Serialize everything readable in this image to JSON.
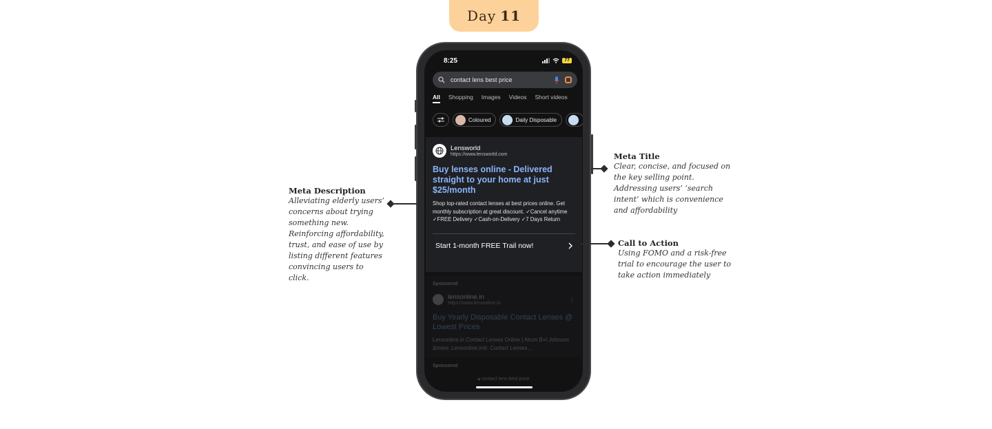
{
  "badge": {
    "label": "Day",
    "number": "11"
  },
  "status_bar": {
    "time": "8:25",
    "battery": "77"
  },
  "search": {
    "query": "contact lens best price"
  },
  "tabs": [
    "All",
    "Shopping",
    "Images",
    "Videos",
    "Short videos"
  ],
  "chips": [
    {
      "label": "Coloured"
    },
    {
      "label": "Daily Disposable"
    }
  ],
  "ad": {
    "site_name": "Lensworld",
    "site_url": "https://www.lensworld.com",
    "title": "Buy lenses online - Delivered straight to your home at just $25/month",
    "description": "Shop top-rated contact lenses at best prices online. Get monthly subscription at great discount. ✓Cancel anytime ✓FREE Delivery ✓Cash-on-Delivery ✓7 Days Return",
    "cta": "Start 1-month FREE Trail now!"
  },
  "ad2": {
    "sponsored": "Sponsored",
    "site_name": "lensonline.in",
    "site_url": "https://www.lensonline.in",
    "title": "Buy Yearly Disposable Contact Lenses @ Lowest Prices",
    "description": "Lensonline.in Contact Lenses Online | Alcon B+l Johnson &more. Lensonline.in®: Contact Lenses..."
  },
  "ad3": {
    "sponsored": "Sponsored"
  },
  "bottom_url": "contact lens best price",
  "annotations": {
    "meta_description": {
      "title": "Meta Description",
      "text": "Alleviating elderly users’ concerns about trying something new. Reinforcing affordability, trust, and ease of use by listing different features convincing users to click."
    },
    "meta_title": {
      "title": "Meta Title",
      "text": "Clear, concise, and focused on the key selling point. Addressing users’ ‘search intent’ which is convenience and affordability"
    },
    "cta": {
      "title": "Call to Action",
      "text": "Using FOMO and a risk-free trial to encourage the user to take action immediately"
    }
  },
  "colors": {
    "badge": "#fdd29a",
    "link_blue": "#8ab4f8",
    "screen_bg": "#121213",
    "card_bg": "#1f2024"
  }
}
